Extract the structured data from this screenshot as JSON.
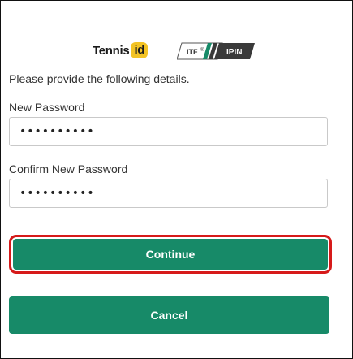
{
  "logos": {
    "tennis_text": "Tennis",
    "tennis_id": "id",
    "itf_text": "ITF",
    "ipin_text": "IPIN"
  },
  "form": {
    "intro": "Please provide the following details.",
    "new_password": {
      "label": "New Password",
      "value": "••••••••••"
    },
    "confirm_password": {
      "label": "Confirm New Password",
      "value": "••••••••••"
    }
  },
  "buttons": {
    "continue_label": "Continue",
    "cancel_label": "Cancel"
  },
  "colors": {
    "primary": "#178a68",
    "highlight_border": "#d61a1a",
    "id_badge": "#f3c324"
  }
}
